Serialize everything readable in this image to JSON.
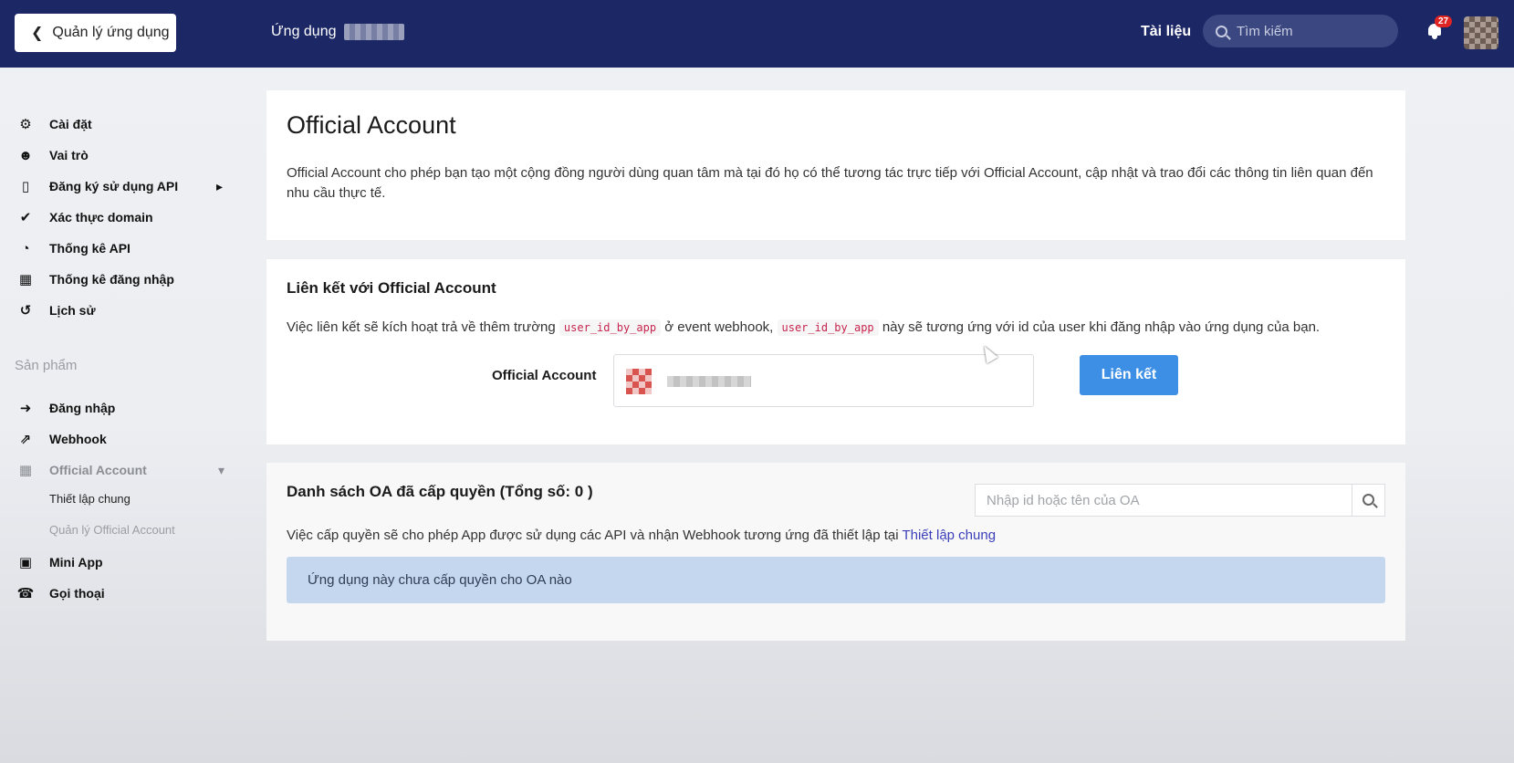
{
  "header": {
    "back_label": "Quản lý ứng dụng",
    "app_title": "Ứng dụng",
    "docs_label": "Tài liệu",
    "search_placeholder": "Tìm kiếm",
    "notification_count": "27"
  },
  "sidebar": {
    "items": [
      {
        "label": "Cài đặt",
        "icon": "gear-icon"
      },
      {
        "label": "Vai trò",
        "icon": "user-circle-icon"
      },
      {
        "label": "Đăng ký sử dụng API",
        "icon": "inbox-icon"
      },
      {
        "label": "Xác thực domain",
        "icon": "check-circle-icon"
      },
      {
        "label": "Thống kê API",
        "icon": "gauge-icon"
      },
      {
        "label": "Thống kê đăng nhập",
        "icon": "bar-chart-icon"
      },
      {
        "label": "Lịch sử",
        "icon": "history-icon"
      }
    ],
    "section_label": "Sản phẩm",
    "products": [
      {
        "label": "Đăng nhập",
        "icon": "sign-in-icon"
      },
      {
        "label": "Webhook",
        "icon": "external-link-icon"
      },
      {
        "label": "Official Account",
        "icon": "id-card-icon"
      },
      {
        "label": "Mini App",
        "icon": "cube-icon"
      },
      {
        "label": "Gọi thoại",
        "icon": "phone-icon"
      }
    ],
    "sub_items": [
      {
        "label": "Thiết lập chung"
      },
      {
        "label": "Quản lý Official Account"
      }
    ]
  },
  "intro": {
    "title": "Official Account",
    "description": "Official Account cho phép bạn tạo một cộng đồng người dùng quan tâm mà tại đó họ có thể tương tác trực tiếp với Official Account, cập nhật và trao đổi các thông tin liên quan đến nhu cầu thực tế."
  },
  "link_section": {
    "title": "Liên kết với Official Account",
    "desc_part1": "Việc liên kết sẽ kích hoạt trả về thêm trường",
    "code_tag": "user_id_by_app",
    "desc_part2": "ở event webhook,",
    "desc_part3": "này sẽ tương ứng với id của user khi đăng nhập vào ứng dụng của bạn.",
    "oa_label": "Official Account",
    "link_button": "Liên kết"
  },
  "oa_list": {
    "title": "Danh sách OA đã cấp quyền (Tổng số: 0 )",
    "search_placeholder": "Nhập id hoặc tên của OA",
    "desc": "Việc cấp quyền sẽ cho phép App được sử dụng các API và nhận Webhook tương ứng đã thiết lập tại",
    "desc_link": "Thiết lập chung",
    "empty_message": "Ứng dụng này chưa cấp quyền cho OA nào"
  },
  "colors": {
    "header_bg": "#1c2766",
    "primary_button": "#3d8fe6",
    "alert_bg": "#c5d7ee",
    "badge": "#e02424",
    "link": "#3b3fb8"
  }
}
